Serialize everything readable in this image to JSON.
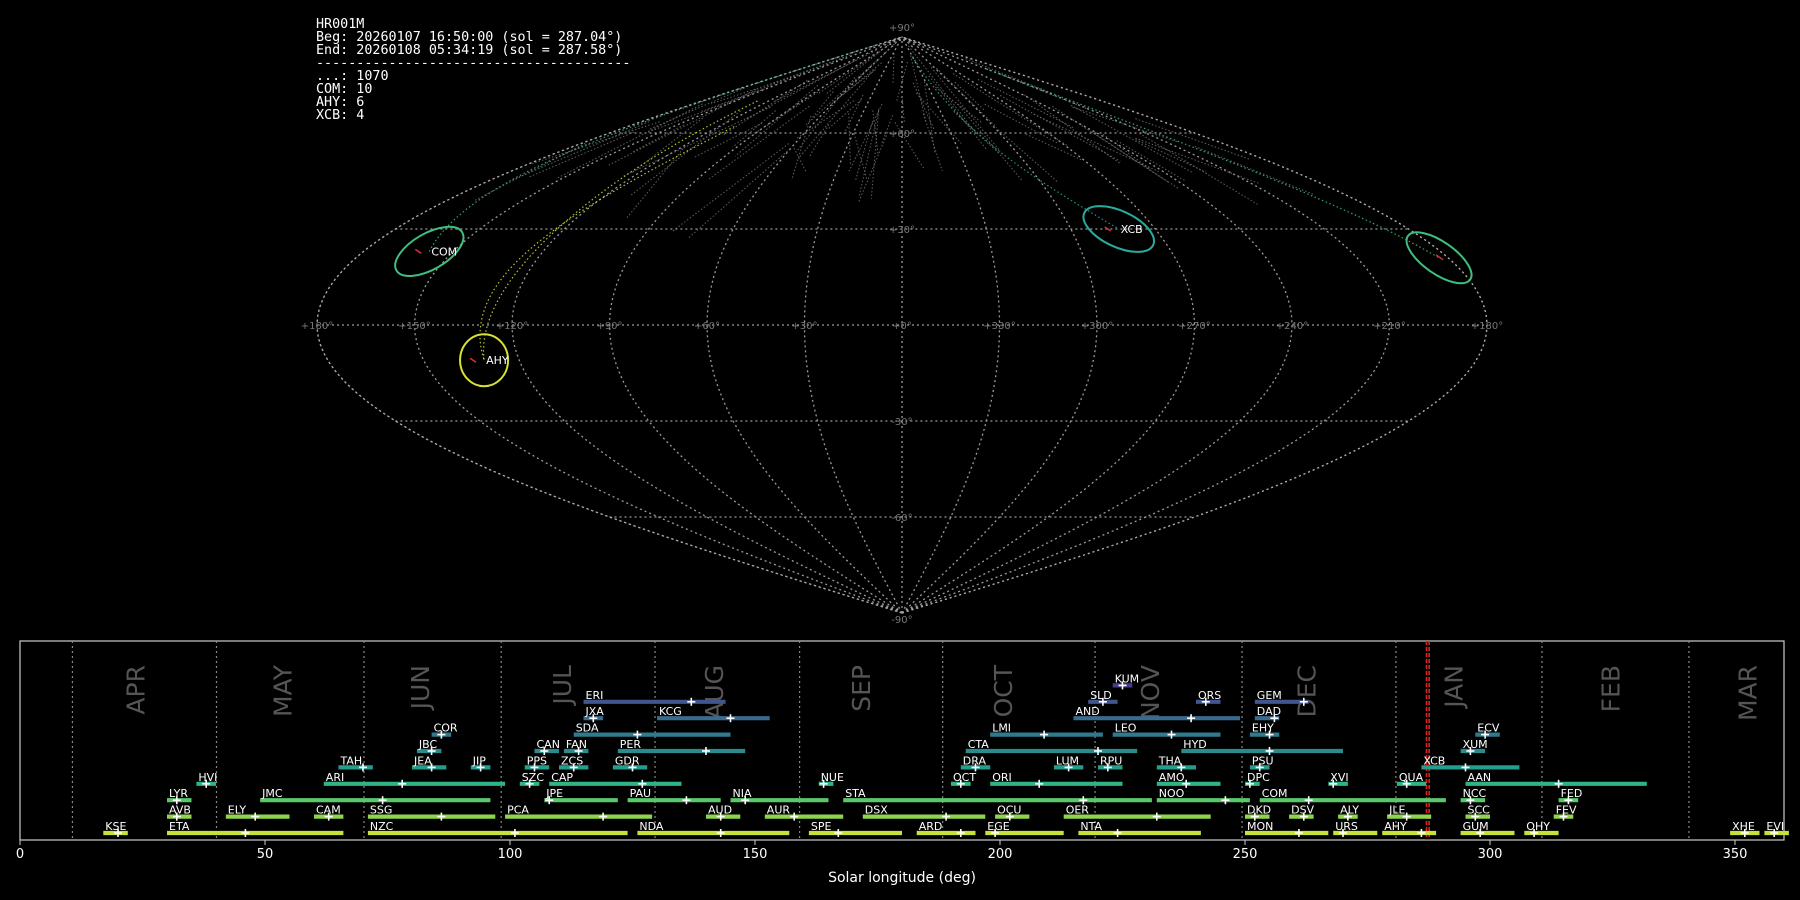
{
  "info": {
    "station": "HR001M",
    "beg": "Beg: 20260107 16:50:00 (sol = 287.04°)",
    "end": "End: 20260108 05:34:19 (sol = 287.58°)",
    "separator": "---------------------------------------",
    "counts": [
      "...: 1070",
      "COM: 10",
      "AHY: 6",
      "XCB: 4"
    ]
  },
  "chart_data": [
    {
      "type": "sky-map-sinusoidal",
      "meridian_labels": [
        "+180°",
        "+150°",
        "+120°",
        "+90°",
        "+60°",
        "+30°",
        "+0°",
        "+330°",
        "+300°",
        "+270°",
        "+240°",
        "+210°",
        "+180°"
      ],
      "meridian_values": [
        180,
        150,
        120,
        90,
        60,
        30,
        0,
        330,
        300,
        270,
        240,
        210,
        180
      ],
      "parallel_labels": [
        "+90°",
        "+60°",
        "+30°",
        "-30°",
        "-60°",
        "-90°"
      ],
      "parallel_values": [
        90,
        60,
        30,
        -30,
        -60,
        -90
      ],
      "radiants": [
        {
          "name": "COM",
          "lon": 158,
          "lat": 23,
          "color": "#3fbf7f"
        },
        {
          "name": "AHY",
          "lon": 131,
          "lat": -11,
          "color": "#d8e030"
        },
        {
          "name": "XCB",
          "lon": 283,
          "lat": 30,
          "color": "#2aaa9a"
        }
      ],
      "unlabeled_radiants": [
        {
          "lon": 183,
          "lat": 21,
          "color": "#3fbf7f"
        }
      ]
    },
    {
      "type": "bar",
      "xlabel": "Solar longitude (deg)",
      "xlim": [
        0,
        360
      ],
      "xticks": [
        0,
        50,
        100,
        150,
        200,
        250,
        300,
        350
      ],
      "month_lines": [
        10.7,
        40.1,
        70.2,
        98.2,
        129.6,
        159.1,
        188.3,
        219.4,
        249.4,
        280.8,
        310.6,
        340.6
      ],
      "month_labels": [
        {
          "label": "APR",
          "at": 24
        },
        {
          "label": "MAY",
          "at": 54
        },
        {
          "label": "JUN",
          "at": 82
        },
        {
          "label": "JUL",
          "at": 111
        },
        {
          "label": "AUG",
          "at": 142
        },
        {
          "label": "SEP",
          "at": 172
        },
        {
          "label": "OCT",
          "at": 201
        },
        {
          "label": "NOV",
          "at": 231
        },
        {
          "label": "DEC",
          "at": 263
        },
        {
          "label": "JAN",
          "at": 293
        },
        {
          "label": "FEB",
          "at": 325
        },
        {
          "label": "MAR",
          "at": 353
        }
      ],
      "current_sol": [
        287.04,
        287.58
      ],
      "showers": [
        {
          "name": "KSE",
          "row": 0,
          "start": 17,
          "end": 22,
          "peak": 20
        },
        {
          "name": "ETA",
          "row": 0,
          "start": 30,
          "end": 66,
          "peak": 46
        },
        {
          "name": "NZC",
          "row": 0,
          "start": 71,
          "end": 124,
          "peak": 101
        },
        {
          "name": "NDA",
          "row": 0,
          "start": 126,
          "end": 157,
          "peak": 143
        },
        {
          "name": "SPE",
          "row": 0,
          "start": 161,
          "end": 180,
          "peak": 167
        },
        {
          "name": "ARD",
          "row": 0,
          "start": 183,
          "end": 195,
          "peak": 192
        },
        {
          "name": "EGE",
          "row": 0,
          "start": 197,
          "end": 213,
          "peak": 199
        },
        {
          "name": "NTA",
          "row": 0,
          "start": 216,
          "end": 241,
          "peak": 224
        },
        {
          "name": "MON",
          "row": 0,
          "start": 250,
          "end": 267,
          "peak": 261
        },
        {
          "name": "URS",
          "row": 0,
          "start": 268,
          "end": 277,
          "peak": 270
        },
        {
          "name": "AHY",
          "row": 0,
          "start": 278,
          "end": 289,
          "peak": 286
        },
        {
          "name": "GUM",
          "row": 0,
          "start": 294,
          "end": 305,
          "peak": 298
        },
        {
          "name": "OHY",
          "row": 0,
          "start": 307,
          "end": 314,
          "peak": 309
        },
        {
          "name": "XHE",
          "row": 0,
          "start": 349,
          "end": 355,
          "peak": 352
        },
        {
          "name": "EVI",
          "row": 0,
          "start": 356,
          "end": 361,
          "peak": 358
        },
        {
          "name": "AVB",
          "row": 1,
          "start": 30,
          "end": 35,
          "peak": 32
        },
        {
          "name": "ELY",
          "row": 1,
          "start": 42,
          "end": 55,
          "peak": 48
        },
        {
          "name": "CAM",
          "row": 1,
          "start": 60,
          "end": 66,
          "peak": 63
        },
        {
          "name": "SSG",
          "row": 1,
          "start": 71,
          "end": 97,
          "peak": 86
        },
        {
          "name": "PCA",
          "row": 1,
          "start": 99,
          "end": 129,
          "peak": 119
        },
        {
          "name": "AUD",
          "row": 1,
          "start": 140,
          "end": 147,
          "peak": 143
        },
        {
          "name": "AUR",
          "row": 1,
          "start": 152,
          "end": 168,
          "peak": 158
        },
        {
          "name": "DSX",
          "row": 1,
          "start": 172,
          "end": 197,
          "peak": 189
        },
        {
          "name": "OCU",
          "row": 1,
          "start": 199,
          "end": 206,
          "peak": 202
        },
        {
          "name": "OER",
          "row": 1,
          "start": 213,
          "end": 243,
          "peak": 232
        },
        {
          "name": "DKD",
          "row": 1,
          "start": 250,
          "end": 255,
          "peak": 252
        },
        {
          "name": "DSV",
          "row": 1,
          "start": 259,
          "end": 264,
          "peak": 262
        },
        {
          "name": "ALY",
          "row": 1,
          "start": 269,
          "end": 273,
          "peak": 271
        },
        {
          "name": "JLE",
          "row": 1,
          "start": 279,
          "end": 288,
          "peak": 283
        },
        {
          "name": "SCC",
          "row": 1,
          "start": 295,
          "end": 300,
          "peak": 297
        },
        {
          "name": "FEV",
          "row": 1,
          "start": 313,
          "end": 317,
          "peak": 315
        },
        {
          "name": "LYR",
          "row": 2,
          "start": 30,
          "end": 35,
          "peak": 32
        },
        {
          "name": "JMC",
          "row": 2,
          "start": 49,
          "end": 96,
          "peak": 74
        },
        {
          "name": "JPE",
          "row": 2,
          "start": 107,
          "end": 122,
          "peak": 108
        },
        {
          "name": "PAU",
          "row": 2,
          "start": 124,
          "end": 143,
          "peak": 136
        },
        {
          "name": "NIA",
          "row": 2,
          "start": 145,
          "end": 165,
          "peak": 148
        },
        {
          "name": "STA",
          "row": 2,
          "start": 168,
          "end": 231,
          "peak": 217
        },
        {
          "name": "NOO",
          "row": 2,
          "start": 232,
          "end": 251,
          "peak": 246
        },
        {
          "name": "COM",
          "row": 2,
          "start": 253,
          "end": 291,
          "peak": 263
        },
        {
          "name": "NCC",
          "row": 2,
          "start": 294,
          "end": 299,
          "peak": 296
        },
        {
          "name": "FED",
          "row": 2,
          "start": 314,
          "end": 318,
          "peak": 316
        },
        {
          "name": "HVI",
          "row": 3,
          "start": 36,
          "end": 40,
          "peak": 38
        },
        {
          "name": "ARI",
          "row": 3,
          "start": 62,
          "end": 99,
          "peak": 78
        },
        {
          "name": "SZC",
          "row": 3,
          "start": 102,
          "end": 106,
          "peak": 104
        },
        {
          "name": "CAP",
          "row": 3,
          "start": 108,
          "end": 135,
          "peak": 127
        },
        {
          "name": "NUE",
          "row": 3,
          "start": 163,
          "end": 166,
          "peak": 164
        },
        {
          "name": "OCT",
          "row": 3,
          "start": 190,
          "end": 194,
          "peak": 192
        },
        {
          "name": "ORI",
          "row": 3,
          "start": 198,
          "end": 225,
          "peak": 208
        },
        {
          "name": "AMO",
          "row": 3,
          "start": 232,
          "end": 245,
          "peak": 238
        },
        {
          "name": "DPC",
          "row": 3,
          "start": 250,
          "end": 253,
          "peak": 251
        },
        {
          "name": "XVI",
          "row": 3,
          "start": 267,
          "end": 271,
          "peak": 268
        },
        {
          "name": "QUA",
          "row": 3,
          "start": 281,
          "end": 287,
          "peak": 283
        },
        {
          "name": "AAN",
          "row": 3,
          "start": 295,
          "end": 332,
          "peak": 314
        },
        {
          "name": "TAH",
          "row": 4,
          "start": 65,
          "end": 72,
          "peak": 70
        },
        {
          "name": "JEA",
          "row": 4,
          "start": 80,
          "end": 87,
          "peak": 84
        },
        {
          "name": "JIP",
          "row": 4,
          "start": 92,
          "end": 96,
          "peak": 94
        },
        {
          "name": "PPS",
          "row": 4,
          "start": 103,
          "end": 108,
          "peak": 105
        },
        {
          "name": "ZCS",
          "row": 4,
          "start": 110,
          "end": 116,
          "peak": 113
        },
        {
          "name": "GDR",
          "row": 4,
          "start": 121,
          "end": 128,
          "peak": 125
        },
        {
          "name": "DRA",
          "row": 4,
          "start": 192,
          "end": 198,
          "peak": 195
        },
        {
          "name": "LUM",
          "row": 4,
          "start": 211,
          "end": 217,
          "peak": 214
        },
        {
          "name": "RPU",
          "row": 4,
          "start": 220,
          "end": 225,
          "peak": 222
        },
        {
          "name": "THA",
          "row": 4,
          "start": 232,
          "end": 240,
          "peak": 237
        },
        {
          "name": "PSU",
          "row": 4,
          "start": 251,
          "end": 255,
          "peak": 253
        },
        {
          "name": "XCB",
          "row": 4,
          "start": 286,
          "end": 306,
          "peak": 295
        },
        {
          "name": "JBC",
          "row": 5,
          "start": 81,
          "end": 86,
          "peak": 84
        },
        {
          "name": "CAN",
          "row": 5,
          "start": 105,
          "end": 110,
          "peak": 107
        },
        {
          "name": "FAN",
          "row": 5,
          "start": 111,
          "end": 116,
          "peak": 114
        },
        {
          "name": "PER",
          "row": 5,
          "start": 122,
          "end": 148,
          "peak": 140
        },
        {
          "name": "CTA",
          "row": 5,
          "start": 193,
          "end": 228,
          "peak": 220
        },
        {
          "name": "HYD",
          "row": 5,
          "start": 237,
          "end": 270,
          "peak": 255
        },
        {
          "name": "XUM",
          "row": 5,
          "start": 294,
          "end": 299,
          "peak": 296
        },
        {
          "name": "COR",
          "row": 6,
          "start": 84,
          "end": 88,
          "peak": 86
        },
        {
          "name": "SDA",
          "row": 6,
          "start": 113,
          "end": 145,
          "peak": 126
        },
        {
          "name": "LMI",
          "row": 6,
          "start": 198,
          "end": 221,
          "peak": 209
        },
        {
          "name": "LEO",
          "row": 6,
          "start": 223,
          "end": 245,
          "peak": 235
        },
        {
          "name": "EHY",
          "row": 6,
          "start": 251,
          "end": 257,
          "peak": 255
        },
        {
          "name": "ECV",
          "row": 6,
          "start": 297,
          "end": 302,
          "peak": 299
        },
        {
          "name": "JXA",
          "row": 7,
          "start": 115,
          "end": 119,
          "peak": 117
        },
        {
          "name": "KCG",
          "row": 7,
          "start": 130,
          "end": 153,
          "peak": 145
        },
        {
          "name": "AND",
          "row": 7,
          "start": 215,
          "end": 249,
          "peak": 239
        },
        {
          "name": "DAD",
          "row": 7,
          "start": 252,
          "end": 257,
          "peak": 256
        },
        {
          "name": "ERI",
          "row": 8,
          "start": 115,
          "end": 144,
          "peak": 137
        },
        {
          "name": "SLD",
          "row": 8,
          "start": 218,
          "end": 224,
          "peak": 221
        },
        {
          "name": "ORS",
          "row": 8,
          "start": 240,
          "end": 245,
          "peak": 242
        },
        {
          "name": "GEM",
          "row": 8,
          "start": 252,
          "end": 263,
          "peak": 262
        },
        {
          "name": "KUM",
          "row": 9,
          "start": 223,
          "end": 227,
          "peak": 225
        }
      ]
    }
  ]
}
